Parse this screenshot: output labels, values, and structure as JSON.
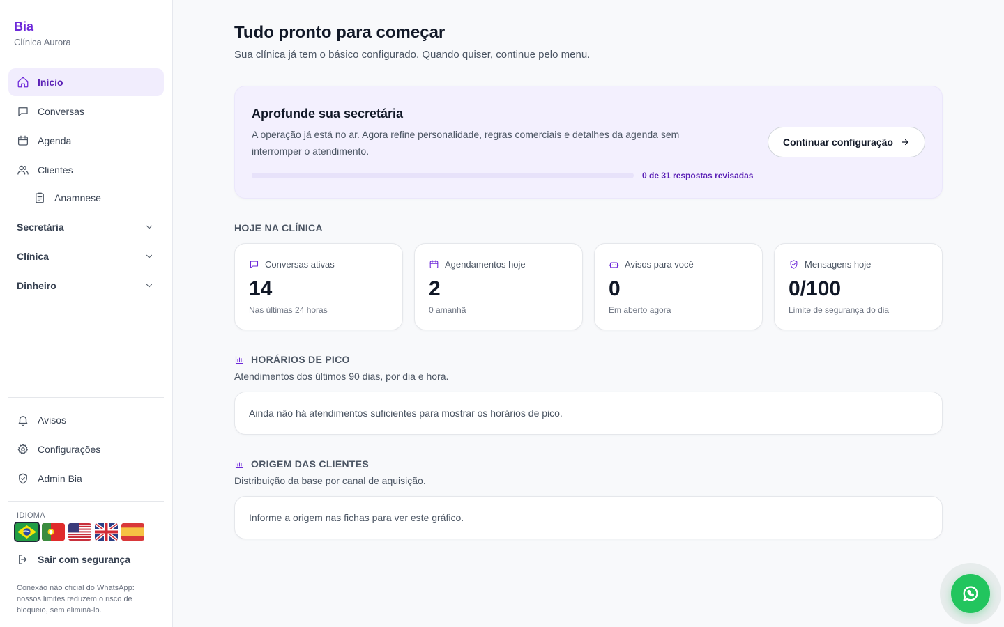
{
  "sidebar": {
    "brand_name": "Bia",
    "brand_subtitle": "Clínica Aurora",
    "nav": [
      {
        "label": "Início",
        "icon": "home-icon",
        "active": true
      },
      {
        "label": "Conversas",
        "icon": "chat-icon"
      },
      {
        "label": "Agenda",
        "icon": "calendar-icon"
      },
      {
        "label": "Clientes",
        "icon": "users-icon"
      },
      {
        "label": "Anamnese",
        "icon": "clipboard-icon"
      }
    ],
    "groups": [
      {
        "label": "Secretária",
        "icon": "chevron-down-icon"
      },
      {
        "label": "Clínica",
        "icon": "chevron-down-icon"
      },
      {
        "label": "Dinheiro",
        "icon": "chevron-down-icon"
      }
    ],
    "bottom_nav": [
      {
        "label": "Avisos",
        "icon": "bell-icon"
      },
      {
        "label": "Configurações",
        "icon": "gear-icon"
      },
      {
        "label": "Admin Bia",
        "icon": "shield-icon"
      }
    ],
    "language_label": "IDIOMA",
    "languages": [
      "Português (Brasil)",
      "Português (Portugal)",
      "English (US)",
      "English (UK)",
      "Español"
    ],
    "selected_language": "Português (Brasil)",
    "logout_label": "Sair com segurança",
    "disclaimer": "Conexão não oficial do WhatsApp: nossos limites reduzem o risco de bloqueio, sem eliminá-lo."
  },
  "main": {
    "title": "Tudo pronto para começar",
    "subtitle": "Sua clínica já tem o básico configurado. Quando quiser, continue pelo menu.",
    "setup": {
      "title": "Aprofunde sua secretária",
      "description": "A operação já está no ar. Agora refine personalidade, regras comerciais e detalhes da agenda sem interromper o atendimento.",
      "progress_done": 0,
      "progress_total": 31,
      "progress_text": "0 de 31 respostas revisadas",
      "button_label": "Continuar configuração"
    },
    "today": {
      "heading": "HOJE NA CLÍNICA",
      "stats": [
        {
          "label": "Conversas ativas",
          "icon": "chat-icon",
          "value": "14",
          "foot": "Nas últimas 24 horas"
        },
        {
          "label": "Agendamentos hoje",
          "icon": "calendar-icon",
          "value": "2",
          "foot": "0 amanhã"
        },
        {
          "label": "Avisos para você",
          "icon": "robot-icon",
          "value": "0",
          "foot": "Em aberto agora"
        },
        {
          "label": "Mensagens hoje",
          "icon": "shield-check-icon",
          "value": "0/100",
          "foot": "Limite de segurança do dia"
        }
      ]
    },
    "peak": {
      "heading": "HORÁRIOS DE PICO",
      "subtitle": "Atendimentos dos últimos 90 dias, por dia e hora.",
      "empty_text": "Ainda não há atendimentos suficientes para mostrar os horários de pico."
    },
    "origin": {
      "heading": "ORIGEM DAS CLIENTES",
      "subtitle": "Distribuição da base por canal de aquisição.",
      "empty_text": "Informe a origem nas fichas para ver este gráfico."
    }
  },
  "colors": {
    "brand": "#6d28d9",
    "active_bg": "#f1edfd",
    "setup_bg": "#f3f0fe",
    "whatsapp": "#22c55e"
  }
}
